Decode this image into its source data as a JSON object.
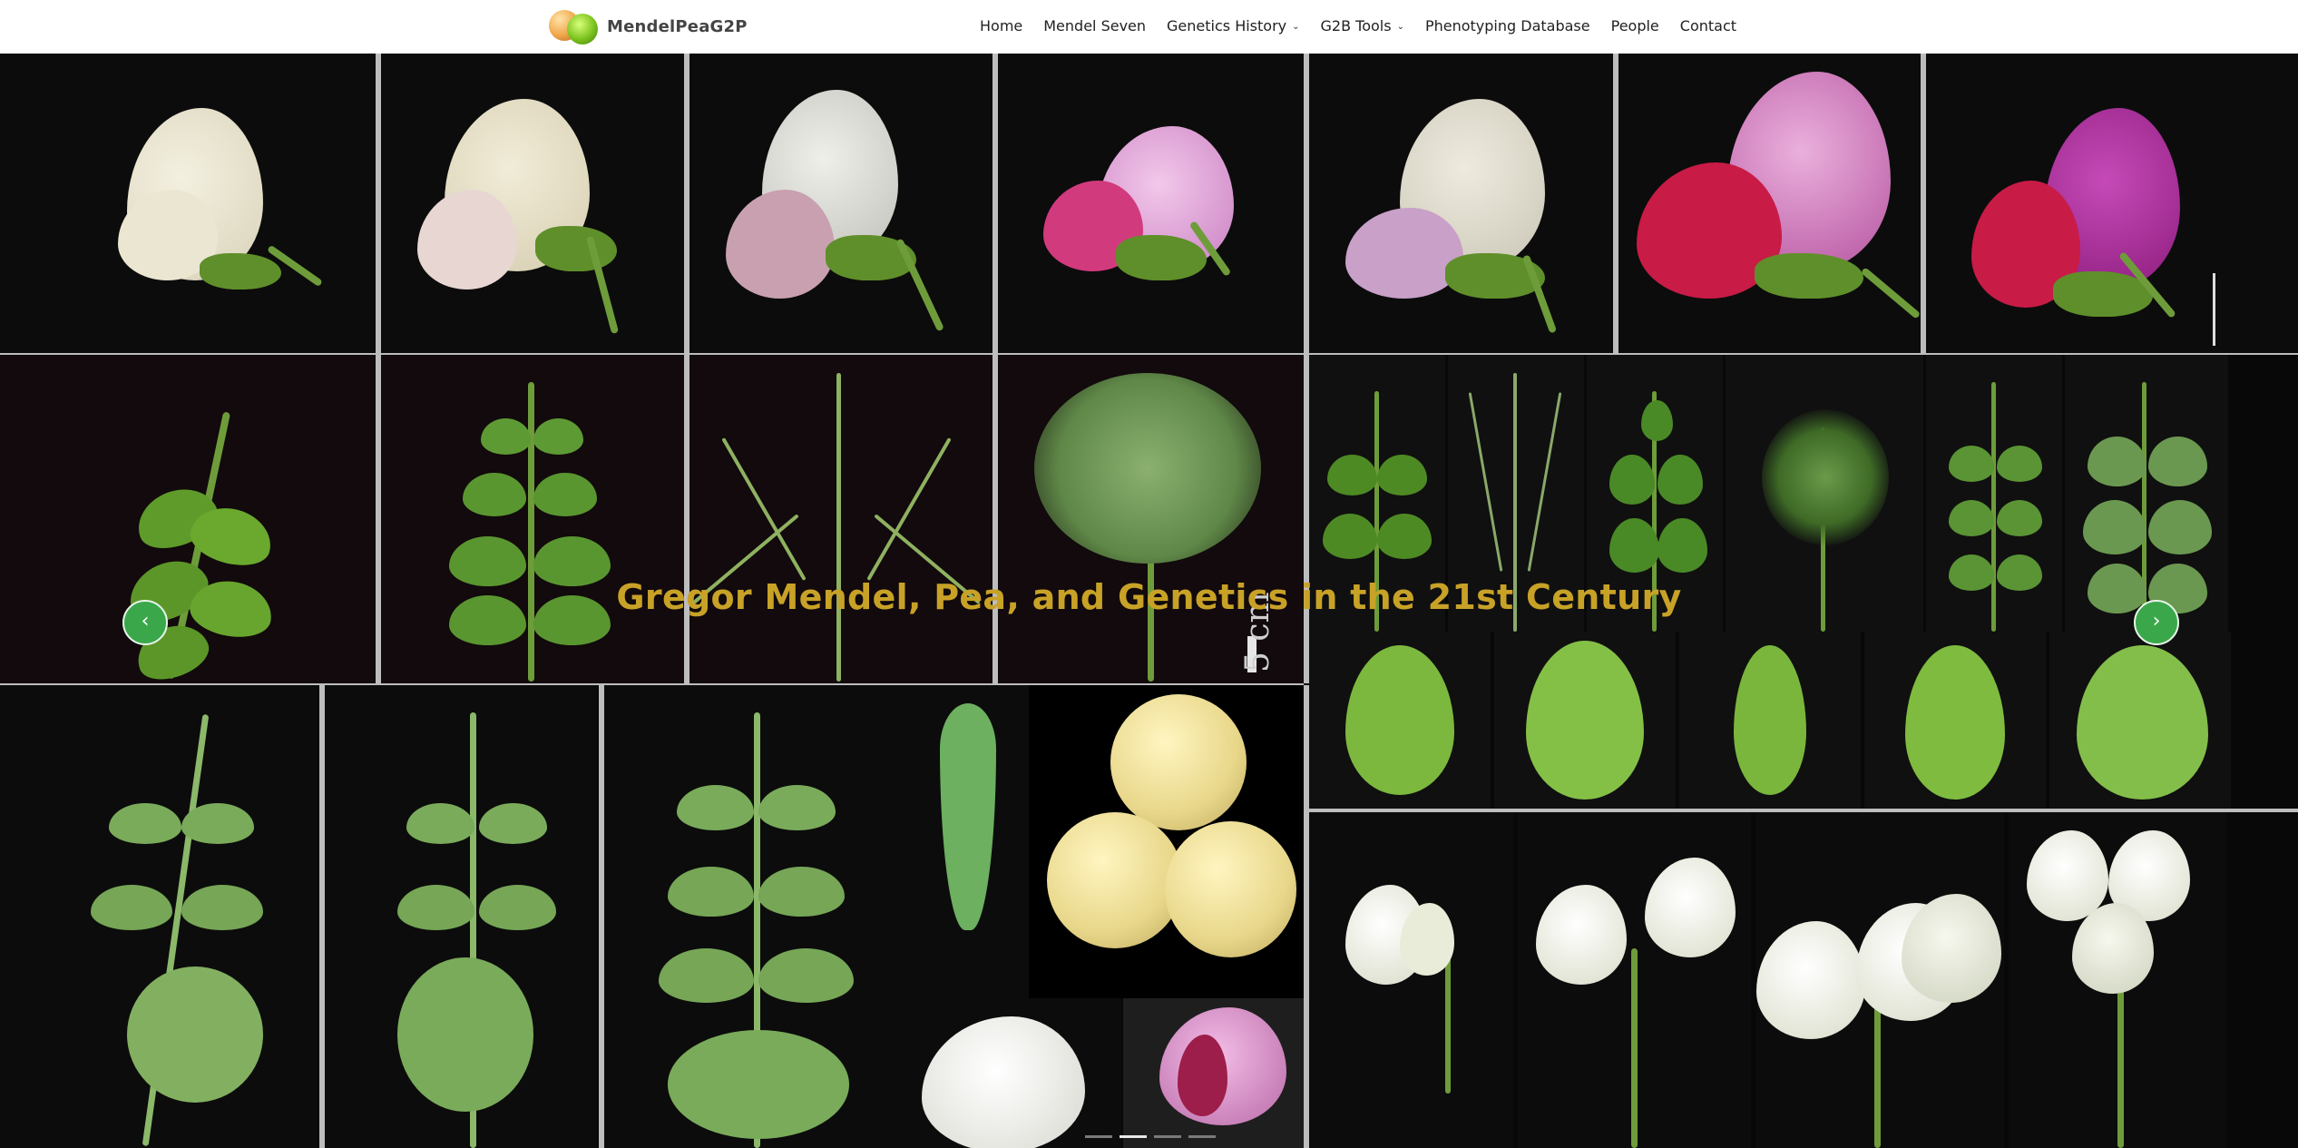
{
  "site": {
    "name": "MendelPeaG2P"
  },
  "nav": {
    "items": [
      {
        "label": "Home",
        "dropdown": false
      },
      {
        "label": "Mendel Seven",
        "dropdown": false
      },
      {
        "label": "Genetics History",
        "dropdown": true
      },
      {
        "label": "G2B Tools",
        "dropdown": true
      },
      {
        "label": "Phenotyping Database",
        "dropdown": false
      },
      {
        "label": "People",
        "dropdown": false
      },
      {
        "label": "Contact",
        "dropdown": false
      }
    ]
  },
  "hero": {
    "title": "Gregor Mendel, Pea, and Genetics in the 21st Century",
    "scale_label": "5 cm",
    "prev_icon": "chevron-left-icon",
    "next_icon": "chevron-right-icon",
    "indicators": {
      "count": 4,
      "active_index": 1
    },
    "colors": {
      "title": "#c8a227",
      "arrow": "#3aa84a"
    }
  }
}
